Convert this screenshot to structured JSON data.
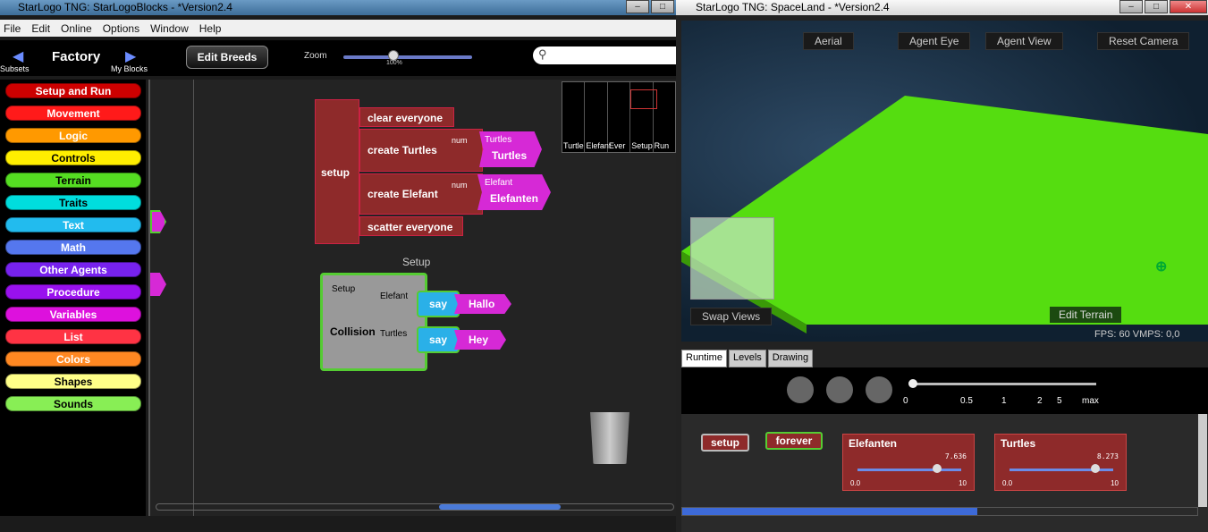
{
  "left_window": {
    "title": "StarLogo TNG: StarLogoBlocks - *Version2.4",
    "menu": [
      "File",
      "Edit",
      "Online",
      "Options",
      "Window",
      "Help"
    ],
    "nav": {
      "subsets": "Subsets",
      "my_blocks": "My Blocks",
      "factory": "Factory"
    },
    "edit_breeds": "Edit Breeds",
    "zoom_label": "Zoom",
    "zoom_pct": "100%",
    "categories": [
      {
        "label": "Setup and Run",
        "color": "#cc0000"
      },
      {
        "label": "Movement",
        "color": "#ff1a1a"
      },
      {
        "label": "Logic",
        "color": "#ff9900"
      },
      {
        "label": "Controls",
        "color": "#ffee00"
      },
      {
        "label": "Terrain",
        "color": "#55dd22"
      },
      {
        "label": "Traits",
        "color": "#00dddd"
      },
      {
        "label": "Text",
        "color": "#22bbee"
      },
      {
        "label": "Math",
        "color": "#5577ee"
      },
      {
        "label": "Other Agents",
        "color": "#7722ee"
      },
      {
        "label": "Procedure",
        "color": "#9911ee"
      },
      {
        "label": "Variables",
        "color": "#dd11dd"
      },
      {
        "label": "List",
        "color": "#ff3344"
      },
      {
        "label": "Colors",
        "color": "#ff8822"
      },
      {
        "label": "Shapes",
        "color": "#ffff88"
      },
      {
        "label": "Sounds",
        "color": "#88ee55"
      }
    ],
    "blocks": {
      "setup": "setup",
      "clear": "clear everyone",
      "create1": "create Turtles",
      "create2": "create Elefant",
      "num": "num",
      "turtles_small": "Turtles",
      "turtles": "Turtles",
      "elefant_small": "Elefant",
      "elefanten": "Elefanten",
      "scatter": "scatter everyone",
      "collision_caption": "Setup",
      "coll_setup": "Setup",
      "coll_elefant": "Elefant",
      "coll_turtles": "Turtles",
      "collision": "Collision",
      "say1": "say",
      "hallo": "Hallo",
      "say2": "say",
      "hey": "Hey"
    },
    "minimap": [
      "Turtle",
      "Elefant",
      "Ever",
      "Setup",
      "Run"
    ]
  },
  "right_window": {
    "title": "StarLogo TNG: SpaceLand - *Version2.4",
    "cameras": [
      "Aerial",
      "Agent Eye",
      "Agent View",
      "Reset Camera"
    ],
    "swap_views": "Swap Views",
    "edit_terrain": "Edit Terrain",
    "fps": "FPS: 60  VMPS: 0,0",
    "tabs": [
      "Runtime",
      "Levels",
      "Drawing"
    ],
    "speed_ticks": [
      "0",
      "0.5",
      "1",
      "2",
      "5",
      "max"
    ],
    "setup_btn": "setup",
    "forever_btn": "forever",
    "sliders": [
      {
        "name": "Elefanten",
        "value": "7.636",
        "min": "0.0",
        "max": "10",
        "fraction": 0.764
      },
      {
        "name": "Turtles",
        "value": "8.273",
        "min": "0.0",
        "max": "10",
        "fraction": 0.827
      }
    ]
  }
}
